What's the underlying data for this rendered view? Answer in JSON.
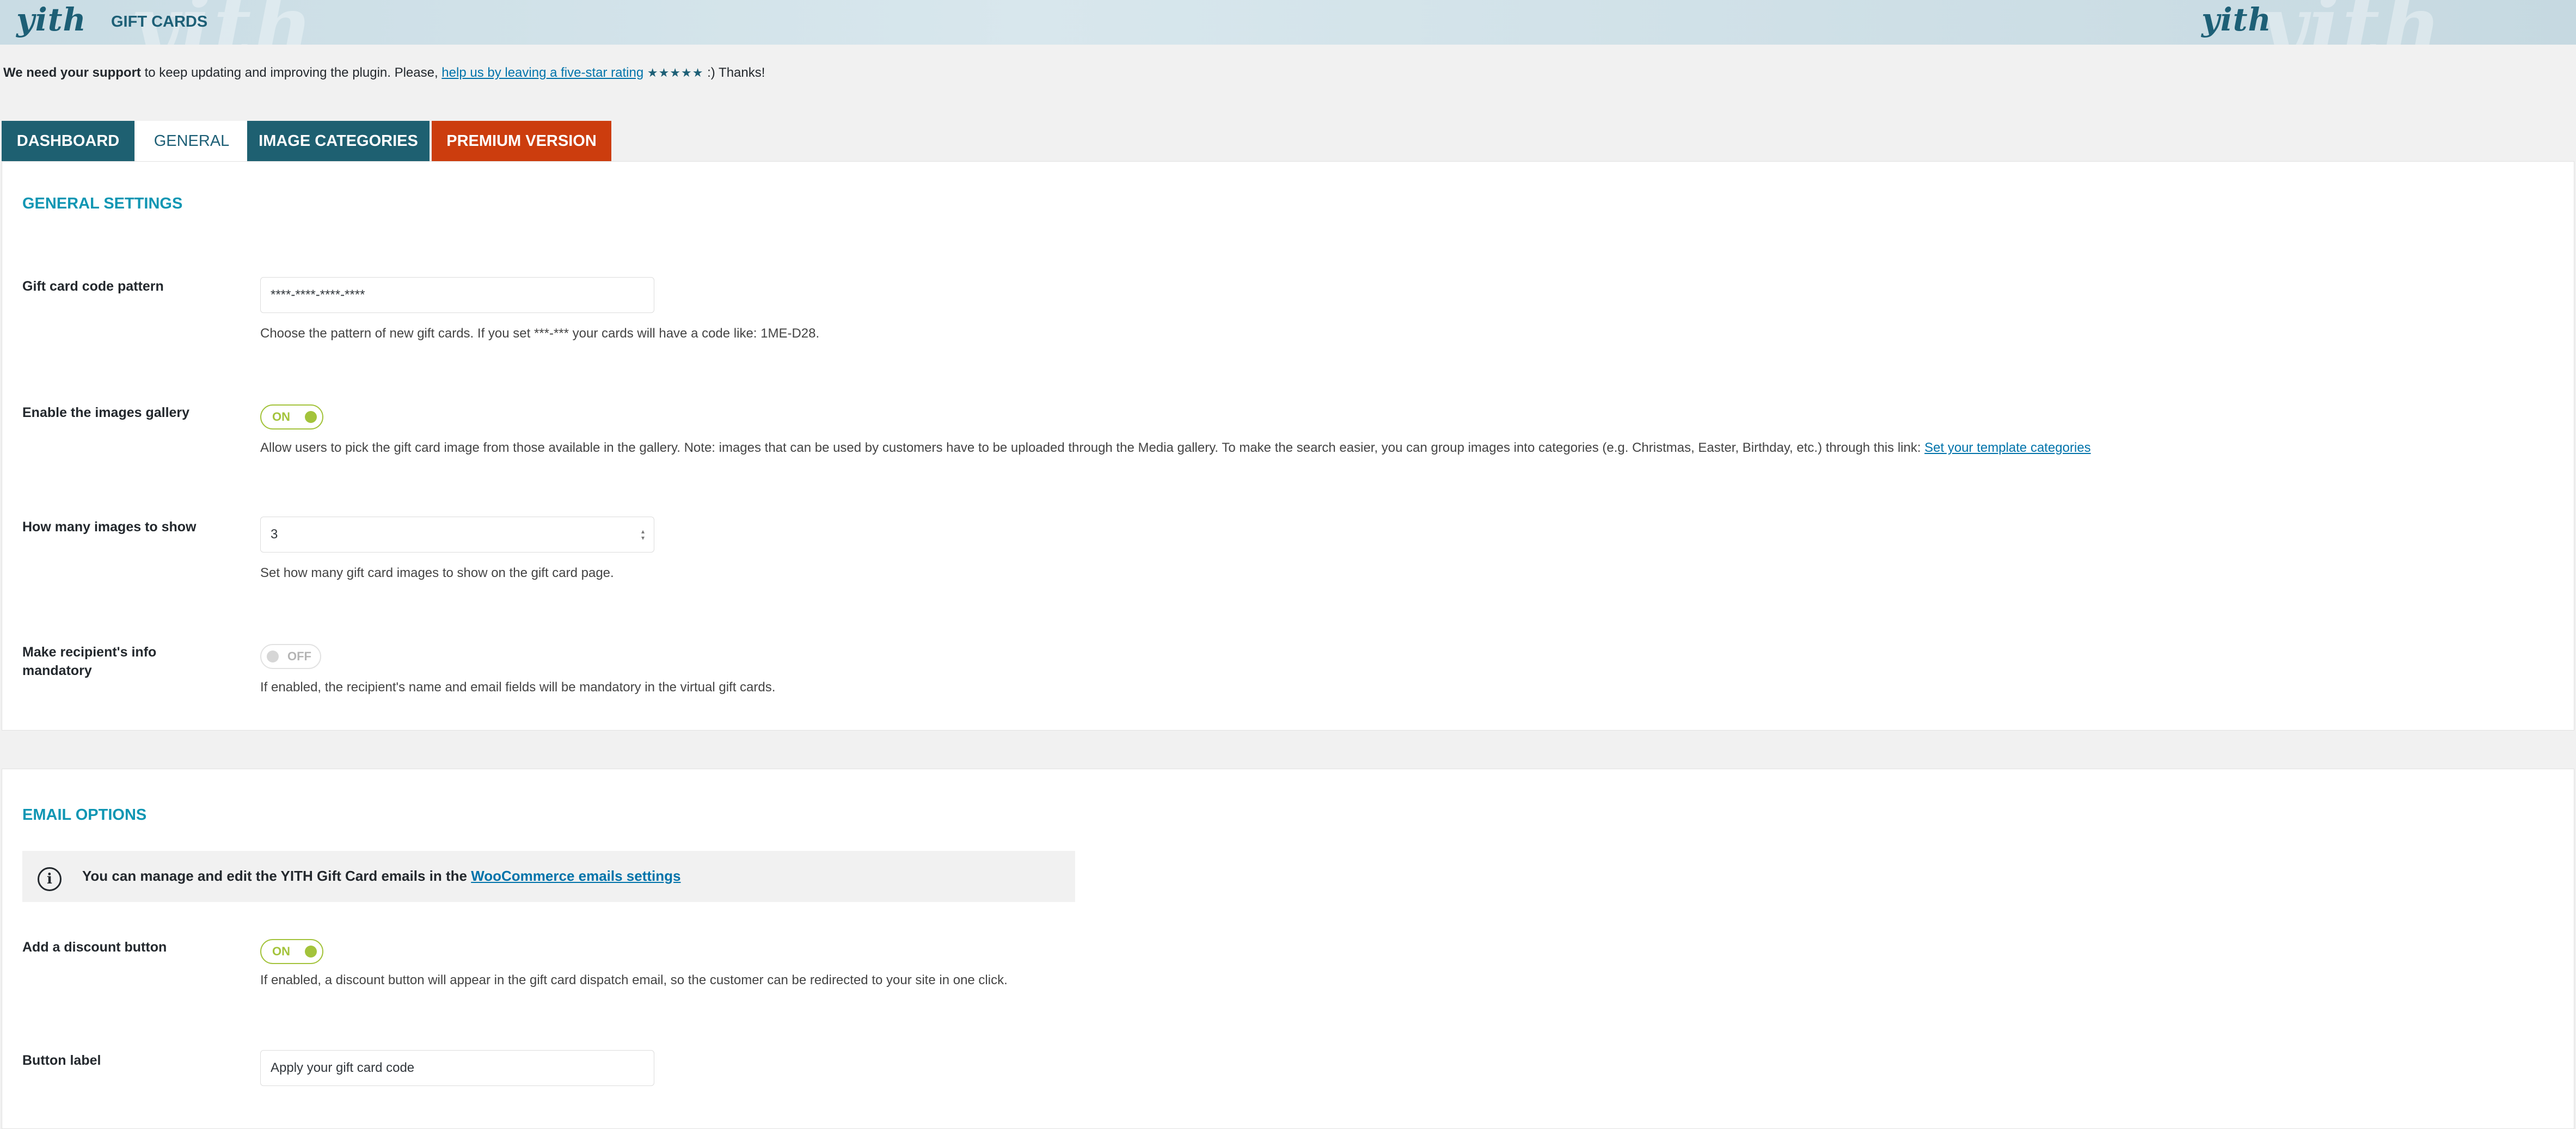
{
  "header": {
    "logo_text": "yith",
    "watermark_text": "yith",
    "plugin_title": "GIFT CARDS"
  },
  "notice": {
    "bold_text": "We need your support",
    "text_before_link": " to keep updating and improving the plugin. Please, ",
    "link_text": "help us by leaving a five-star rating",
    "stars": "★★★★★",
    "text_after": " :) Thanks!"
  },
  "tabs": [
    {
      "label": "DASHBOARD",
      "active": false
    },
    {
      "label": "GENERAL",
      "active": true
    },
    {
      "label": "IMAGE CATEGORIES",
      "active": false
    },
    {
      "label": "PREMIUM VERSION",
      "active": false
    }
  ],
  "general": {
    "section_title": "GENERAL SETTINGS",
    "code_pattern": {
      "label": "Gift card code pattern",
      "value": "****-****-****-****",
      "description": "Choose the pattern of new gift cards. If you set ***-*** your cards will have a code like: 1ME-D28."
    },
    "images_gallery": {
      "label": "Enable the images gallery",
      "toggle_text": "ON",
      "description": "Allow users to pick the gift card image from those available in the gallery. Note: images that can be used by customers have to be uploaded through the Media gallery. To make the search easier, you can group images into categories (e.g. Christmas, Easter, Birthday, etc.) through this link: ",
      "link_text": "Set your template categories"
    },
    "images_count": {
      "label": "How many images to show",
      "value": "3",
      "description": "Set how many gift card images to show on the gift card page."
    },
    "recipient_mandatory": {
      "label": "Make recipient's info mandatory",
      "toggle_text": "OFF",
      "description": "If enabled, the recipient's name and email fields will be mandatory in the virtual gift cards."
    }
  },
  "email": {
    "section_title": "EMAIL OPTIONS",
    "info_text": "You can manage and edit the YITH Gift Card emails in the ",
    "info_link": "WooCommerce emails settings",
    "discount_button": {
      "label": "Add a discount button",
      "toggle_text": "ON",
      "description": "If enabled, a discount button will appear in the gift card dispatch email, so the customer can be redirected to your site in one click."
    },
    "button_label": {
      "label": "Button label",
      "value": "Apply your gift card code"
    }
  },
  "colors": {
    "brand_dark": "#1d5f76",
    "accent_green": "#a3c33b",
    "premium": "#cc3d0e",
    "section_title": "#0f96b3",
    "link": "#0073aa"
  }
}
